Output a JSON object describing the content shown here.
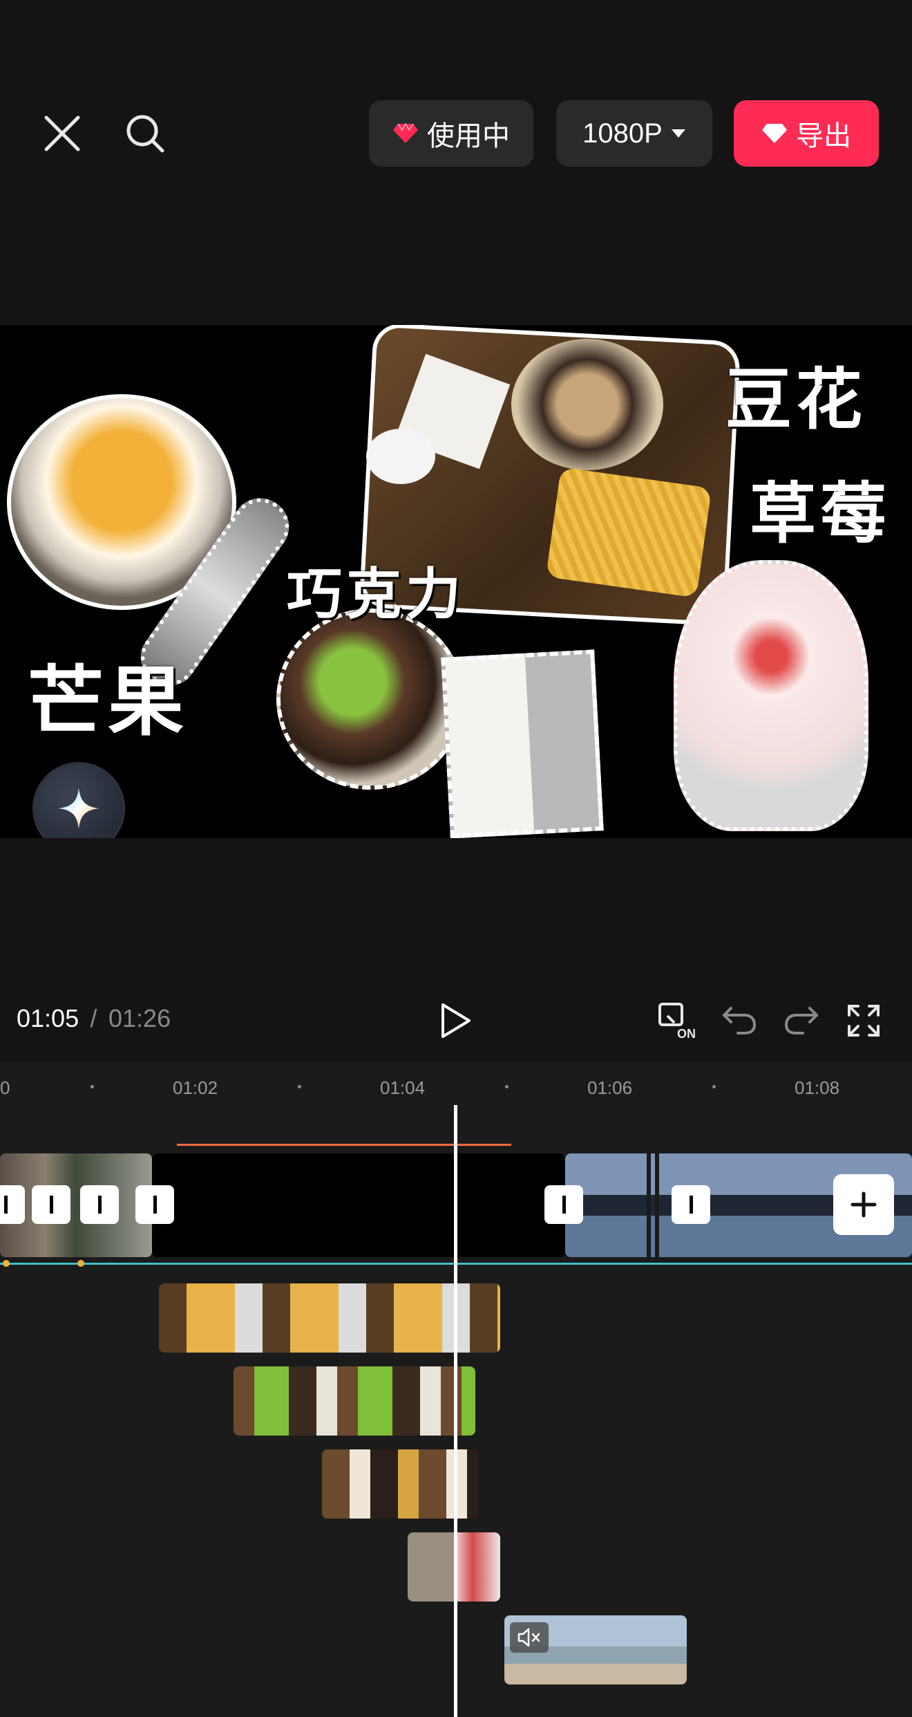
{
  "toolbar": {
    "close_icon": "close-icon",
    "search_icon": "search-icon",
    "pro_badge_label": "使用中",
    "resolution_label": "1080P",
    "export_label": "导出",
    "accent_color": "#ff2b55"
  },
  "preview": {
    "captions": {
      "mango": "芒果",
      "chocolate": "巧克力",
      "tofu_pudding": "豆花",
      "strawberry": "草莓"
    },
    "ai_button_icon": "sparkle-icon"
  },
  "playback": {
    "current_time": "01:05",
    "separator": "/",
    "total_time": "01:26"
  },
  "timeline": {
    "ruler_labels": [
      "0",
      "01:02",
      "01:04",
      "01:06",
      "01:08"
    ],
    "add_clip_icon": "plus-icon",
    "mute_icon": "mute-icon"
  }
}
